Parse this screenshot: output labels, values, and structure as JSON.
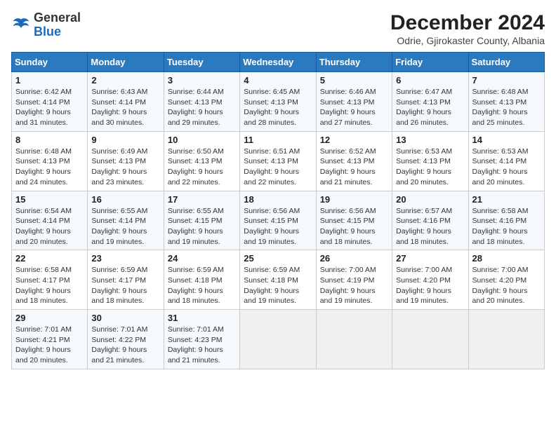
{
  "logo": {
    "general": "General",
    "blue": "Blue"
  },
  "title": "December 2024",
  "subtitle": "Odrie, Gjirokaster County, Albania",
  "weekdays": [
    "Sunday",
    "Monday",
    "Tuesday",
    "Wednesday",
    "Thursday",
    "Friday",
    "Saturday"
  ],
  "weeks": [
    [
      {
        "day": "1",
        "sunrise": "6:42 AM",
        "sunset": "4:14 PM",
        "daylight": "9 hours and 31 minutes."
      },
      {
        "day": "2",
        "sunrise": "6:43 AM",
        "sunset": "4:14 PM",
        "daylight": "9 hours and 30 minutes."
      },
      {
        "day": "3",
        "sunrise": "6:44 AM",
        "sunset": "4:13 PM",
        "daylight": "9 hours and 29 minutes."
      },
      {
        "day": "4",
        "sunrise": "6:45 AM",
        "sunset": "4:13 PM",
        "daylight": "9 hours and 28 minutes."
      },
      {
        "day": "5",
        "sunrise": "6:46 AM",
        "sunset": "4:13 PM",
        "daylight": "9 hours and 27 minutes."
      },
      {
        "day": "6",
        "sunrise": "6:47 AM",
        "sunset": "4:13 PM",
        "daylight": "9 hours and 26 minutes."
      },
      {
        "day": "7",
        "sunrise": "6:48 AM",
        "sunset": "4:13 PM",
        "daylight": "9 hours and 25 minutes."
      }
    ],
    [
      {
        "day": "8",
        "sunrise": "6:48 AM",
        "sunset": "4:13 PM",
        "daylight": "9 hours and 24 minutes."
      },
      {
        "day": "9",
        "sunrise": "6:49 AM",
        "sunset": "4:13 PM",
        "daylight": "9 hours and 23 minutes."
      },
      {
        "day": "10",
        "sunrise": "6:50 AM",
        "sunset": "4:13 PM",
        "daylight": "9 hours and 22 minutes."
      },
      {
        "day": "11",
        "sunrise": "6:51 AM",
        "sunset": "4:13 PM",
        "daylight": "9 hours and 22 minutes."
      },
      {
        "day": "12",
        "sunrise": "6:52 AM",
        "sunset": "4:13 PM",
        "daylight": "9 hours and 21 minutes."
      },
      {
        "day": "13",
        "sunrise": "6:53 AM",
        "sunset": "4:13 PM",
        "daylight": "9 hours and 20 minutes."
      },
      {
        "day": "14",
        "sunrise": "6:53 AM",
        "sunset": "4:14 PM",
        "daylight": "9 hours and 20 minutes."
      }
    ],
    [
      {
        "day": "15",
        "sunrise": "6:54 AM",
        "sunset": "4:14 PM",
        "daylight": "9 hours and 20 minutes."
      },
      {
        "day": "16",
        "sunrise": "6:55 AM",
        "sunset": "4:14 PM",
        "daylight": "9 hours and 19 minutes."
      },
      {
        "day": "17",
        "sunrise": "6:55 AM",
        "sunset": "4:15 PM",
        "daylight": "9 hours and 19 minutes."
      },
      {
        "day": "18",
        "sunrise": "6:56 AM",
        "sunset": "4:15 PM",
        "daylight": "9 hours and 19 minutes."
      },
      {
        "day": "19",
        "sunrise": "6:56 AM",
        "sunset": "4:15 PM",
        "daylight": "9 hours and 18 minutes."
      },
      {
        "day": "20",
        "sunrise": "6:57 AM",
        "sunset": "4:16 PM",
        "daylight": "9 hours and 18 minutes."
      },
      {
        "day": "21",
        "sunrise": "6:58 AM",
        "sunset": "4:16 PM",
        "daylight": "9 hours and 18 minutes."
      }
    ],
    [
      {
        "day": "22",
        "sunrise": "6:58 AM",
        "sunset": "4:17 PM",
        "daylight": "9 hours and 18 minutes."
      },
      {
        "day": "23",
        "sunrise": "6:59 AM",
        "sunset": "4:17 PM",
        "daylight": "9 hours and 18 minutes."
      },
      {
        "day": "24",
        "sunrise": "6:59 AM",
        "sunset": "4:18 PM",
        "daylight": "9 hours and 18 minutes."
      },
      {
        "day": "25",
        "sunrise": "6:59 AM",
        "sunset": "4:18 PM",
        "daylight": "9 hours and 19 minutes."
      },
      {
        "day": "26",
        "sunrise": "7:00 AM",
        "sunset": "4:19 PM",
        "daylight": "9 hours and 19 minutes."
      },
      {
        "day": "27",
        "sunrise": "7:00 AM",
        "sunset": "4:20 PM",
        "daylight": "9 hours and 19 minutes."
      },
      {
        "day": "28",
        "sunrise": "7:00 AM",
        "sunset": "4:20 PM",
        "daylight": "9 hours and 20 minutes."
      }
    ],
    [
      {
        "day": "29",
        "sunrise": "7:01 AM",
        "sunset": "4:21 PM",
        "daylight": "9 hours and 20 minutes."
      },
      {
        "day": "30",
        "sunrise": "7:01 AM",
        "sunset": "4:22 PM",
        "daylight": "9 hours and 21 minutes."
      },
      {
        "day": "31",
        "sunrise": "7:01 AM",
        "sunset": "4:23 PM",
        "daylight": "9 hours and 21 minutes."
      },
      null,
      null,
      null,
      null
    ]
  ]
}
